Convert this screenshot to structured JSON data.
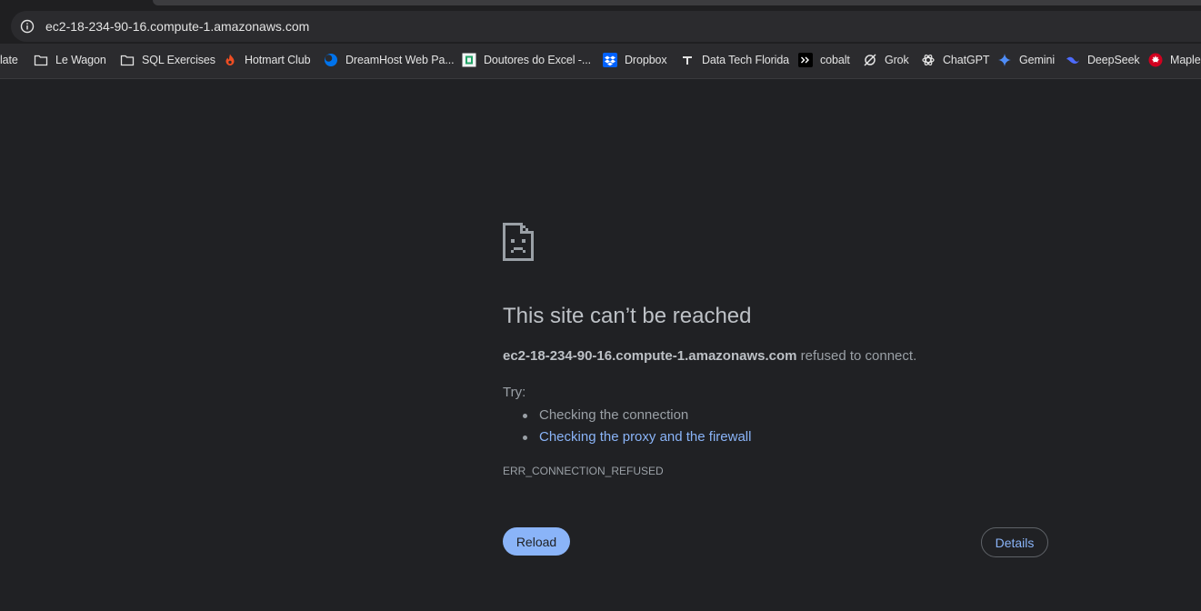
{
  "address_bar": {
    "url": "ec2-18-234-90-16.compute-1.amazonaws.com"
  },
  "bookmarks": [
    {
      "label": "late",
      "icon": "none"
    },
    {
      "label": "Le Wagon",
      "icon": "folder-icon"
    },
    {
      "label": "SQL Exercises",
      "icon": "folder-icon"
    },
    {
      "label": "Hotmart Club",
      "icon": "hotmart-icon"
    },
    {
      "label": "DreamHost Web Pa...",
      "icon": "dreamhost-icon"
    },
    {
      "label": "Doutores do Excel -...",
      "icon": "doutores-icon"
    },
    {
      "label": "Dropbox",
      "icon": "dropbox-icon"
    },
    {
      "label": "Data Tech Florida",
      "icon": "datatech-icon"
    },
    {
      "label": "cobalt",
      "icon": "cobalt-icon"
    },
    {
      "label": "Grok",
      "icon": "grok-icon"
    },
    {
      "label": "ChatGPT",
      "icon": "chatgpt-icon"
    },
    {
      "label": "Gemini",
      "icon": "gemini-icon"
    },
    {
      "label": "DeepSeek",
      "icon": "deepseek-icon"
    },
    {
      "label": "Maple",
      "icon": "maple-icon"
    }
  ],
  "error_page": {
    "title": "This site can’t be reached",
    "host": "ec2-18-234-90-16.compute-1.amazonaws.com",
    "message_suffix": " refused to connect.",
    "try_label": "Try:",
    "suggestions": [
      {
        "text": "Checking the connection",
        "is_link": false
      },
      {
        "text": "Checking the proxy and the firewall",
        "is_link": true
      }
    ],
    "error_code": "ERR_CONNECTION_REFUSED",
    "reload_label": "Reload",
    "details_label": "Details"
  },
  "colors": {
    "background": "#202124",
    "accent": "#8ab4f8",
    "title_text": "#bdc1c6",
    "body_text": "#9aa0a6"
  }
}
